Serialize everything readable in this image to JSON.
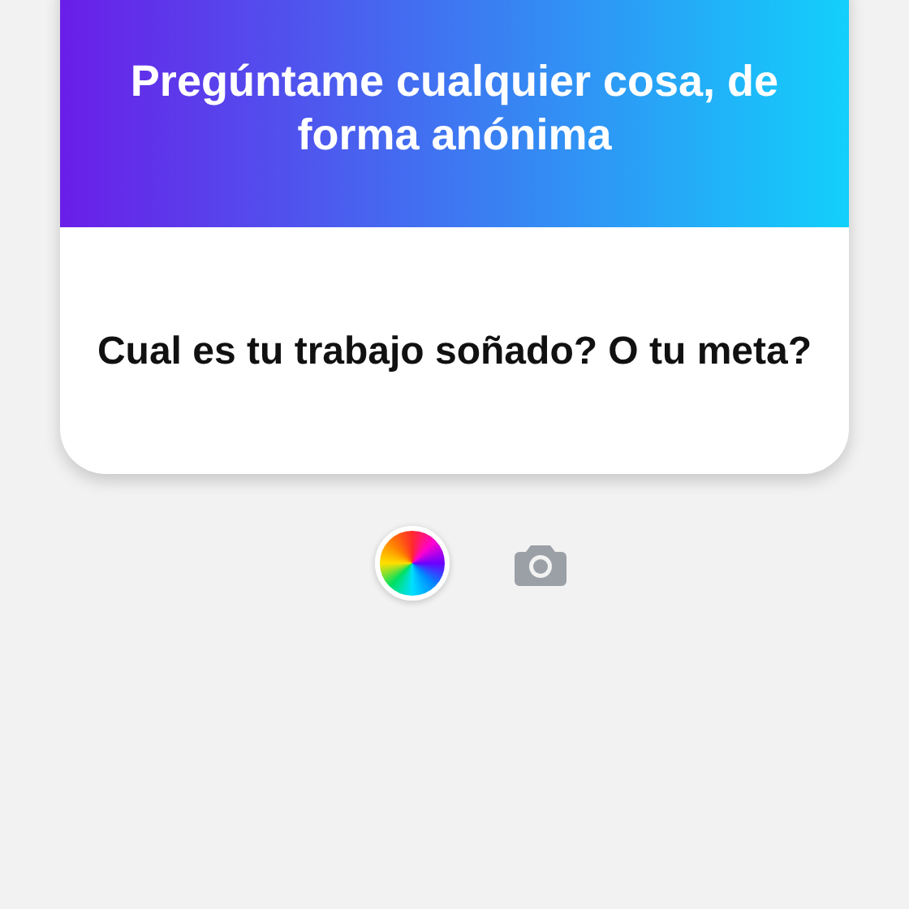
{
  "header": {
    "title": "Pregúntame cualquier cosa, de forma anónima"
  },
  "question": {
    "text": "Cual es tu trabajo soñado? O tu meta?"
  }
}
